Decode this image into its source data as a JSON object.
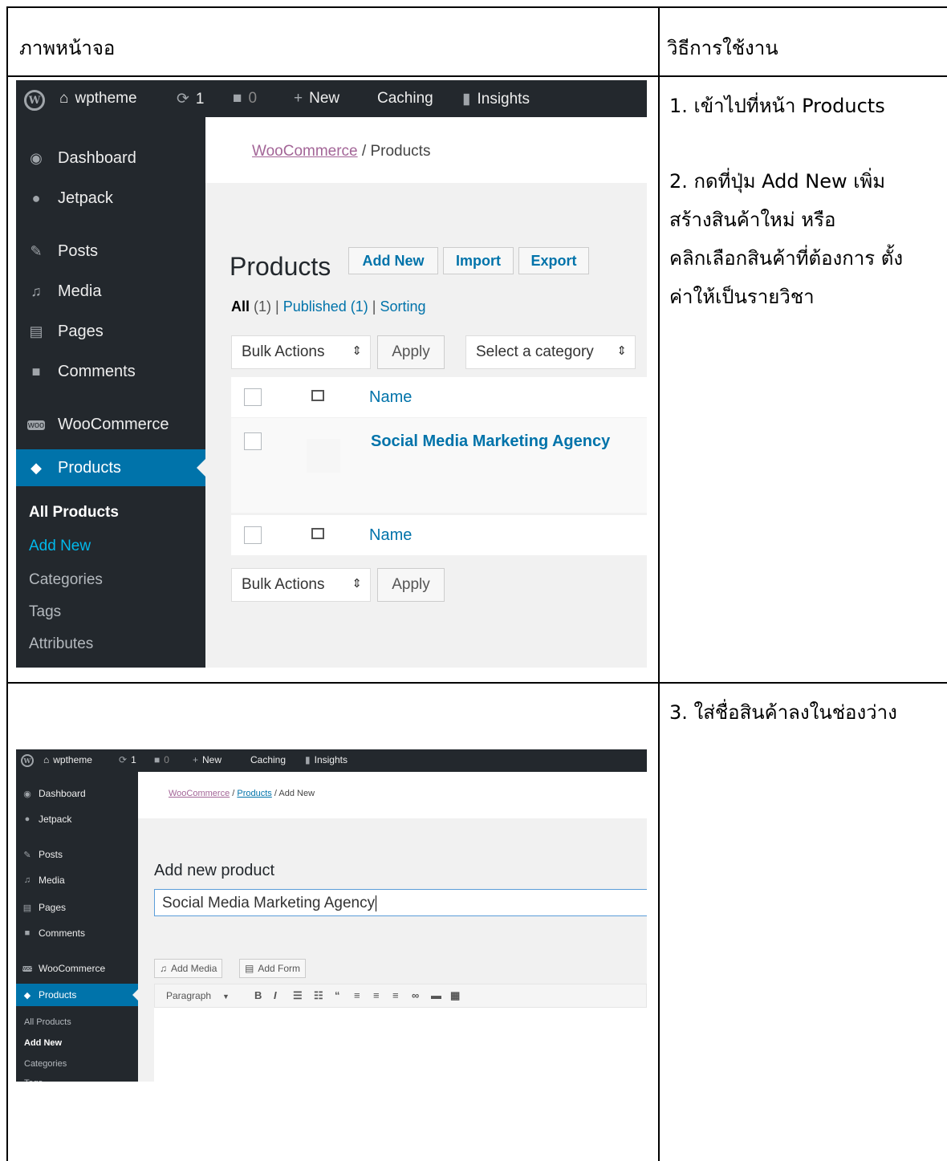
{
  "table": {
    "header_left": "ภาพหน้าจอ",
    "header_right": "วิธีการใช้งาน",
    "step1": "1. เข้าไปที่หน้า Products",
    "step2_lines": [
      "2. กดที่ปุ่ม Add New เพิ่ม",
      "สร้างสินค้าใหม่ หรือ",
      "คลิกเลือกสินค้าที่ต้องการ ตั้ง",
      "ค่าให้เป็นรายวิชา"
    ],
    "step3": "3. ใส่ชื่อสินค้าลงในช่องว่าง"
  },
  "adminbar": {
    "site_name": "wptheme",
    "updates_count": "1",
    "comments_count": "0",
    "new_label": "New",
    "caching_label": "Caching",
    "insights_label": "Insights"
  },
  "sidebar": {
    "dashboard": "Dashboard",
    "jetpack": "Jetpack",
    "posts": "Posts",
    "media": "Media",
    "pages": "Pages",
    "comments": "Comments",
    "woocommerce": "WooCommerce",
    "products": "Products",
    "sub": [
      "All Products",
      "Add New",
      "Categories",
      "Tags",
      "Attributes"
    ]
  },
  "screen1": {
    "breadcrumb_link": "WooCommerce",
    "breadcrumb_rest": " / Products",
    "page_title": "Products",
    "buttons": [
      "Add New",
      "Import",
      "Export"
    ],
    "filter_all": "All",
    "filter_all_count": " (1) | ",
    "filter_published": "Published (1)",
    "filter_sep": " | ",
    "filter_sorting": "Sorting",
    "bulk_actions": "Bulk Actions",
    "apply": "Apply",
    "select_category": "Select a category",
    "col_name": "Name",
    "product_name": "Social Media Marketing Agency"
  },
  "screen2": {
    "breadcrumb_link1": "WooCommerce",
    "breadcrumb_sep": " / ",
    "breadcrumb_link2": "Products",
    "breadcrumb_rest": " / Add New",
    "page_title": "Add new product",
    "title_value": "Social Media Marketing Agency",
    "add_media": "Add Media",
    "add_form": "Add Form",
    "format_select": "Paragraph"
  },
  "colors": {
    "wp_dark": "#23282d",
    "wp_blue": "#0073aa",
    "woo_purple": "#a36597"
  }
}
